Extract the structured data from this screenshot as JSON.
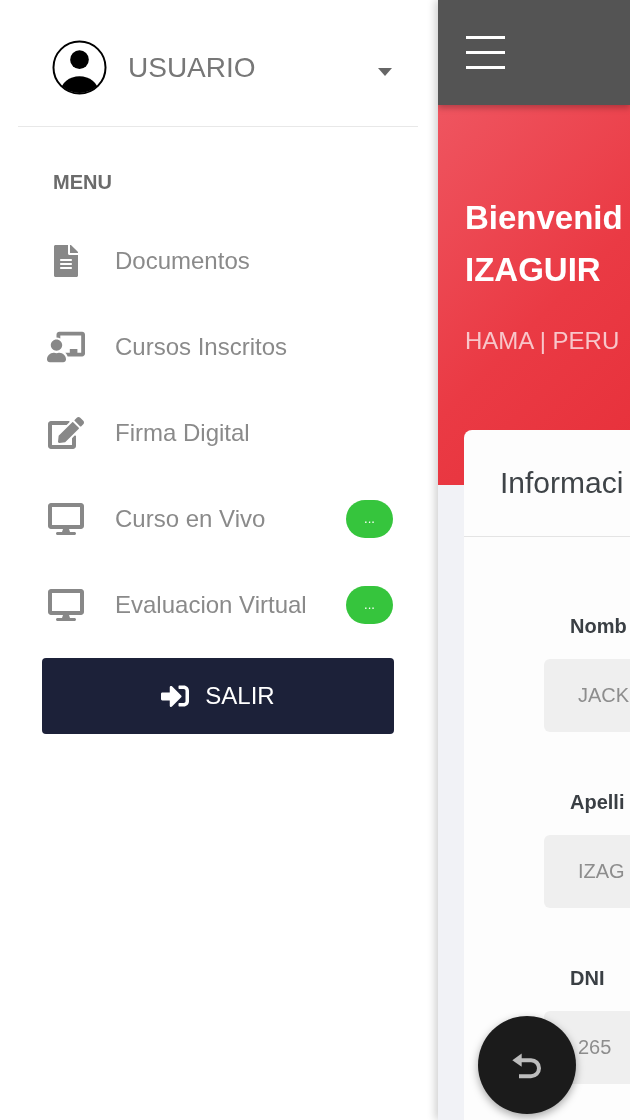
{
  "sidebar": {
    "user_name": "USUARIO",
    "menu_heading": "MENU",
    "items": [
      {
        "label": "Documentos"
      },
      {
        "label": "Cursos Inscritos"
      },
      {
        "label": "Firma Digital"
      },
      {
        "label": "Curso en Vivo",
        "badge": "..."
      },
      {
        "label": "Evaluacion Virtual",
        "badge": "..."
      }
    ],
    "logout_label": "SALIR"
  },
  "banner": {
    "greeting": "Bienvenid",
    "name": "IZAGUIR",
    "subtitle": "HAMA | PERU"
  },
  "card": {
    "title": "Informaci",
    "fields": [
      {
        "label": "Nomb",
        "value": "JACK",
        "disabled": true
      },
      {
        "label": "Apelli",
        "value": "IZAG",
        "disabled": true
      },
      {
        "label": "DNI",
        "value": "265",
        "disabled": true
      }
    ]
  }
}
